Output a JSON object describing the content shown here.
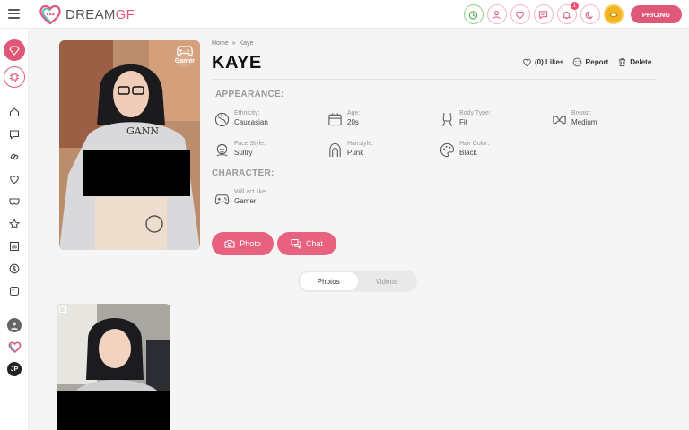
{
  "brand": {
    "name_part1": "DREAM",
    "name_part2": "GF"
  },
  "topbar": {
    "pricing_label": "PRICING",
    "notification_count": "1",
    "icons": [
      "timer-icon",
      "user-icon",
      "heart-icon",
      "chat-icon",
      "bell-icon",
      "moon-icon",
      "coin-icon"
    ]
  },
  "profile": {
    "breadcrumb_home": "Home",
    "breadcrumb_sep": "»",
    "breadcrumb_current": "Kaye",
    "name": "KAYE",
    "image_tag": "Gamer",
    "likes_label": "(0) Likes",
    "report_label": "Report",
    "delete_label": "Delete"
  },
  "appearance": {
    "title": "APPEARANCE:",
    "ethnicity": {
      "label": "Ethnicity:",
      "value": "Caucasian"
    },
    "age": {
      "label": "Age:",
      "value": "20s"
    },
    "body_type": {
      "label": "Body Type:",
      "value": "Fit"
    },
    "breast": {
      "label": "Breast:",
      "value": "Medium"
    },
    "face_style": {
      "label": "Face Style:",
      "value": "Sultry"
    },
    "hairstyle": {
      "label": "Hairstyle:",
      "value": "Punk"
    },
    "hair_color": {
      "label": "Hair Color:",
      "value": "Black"
    }
  },
  "character": {
    "title": "CHARACTER:",
    "will_act_like": {
      "label": "Will act like:",
      "value": "Gamer"
    }
  },
  "buttons": {
    "photo": "Photo",
    "chat": "Chat"
  },
  "tabs": [
    {
      "label": "Photos",
      "active": true
    },
    {
      "label": "Videos",
      "active": false
    }
  ],
  "sidebar": {
    "avatar_initials": "JP"
  },
  "colors": {
    "accent": "#e05877",
    "button": "#e8617e"
  }
}
